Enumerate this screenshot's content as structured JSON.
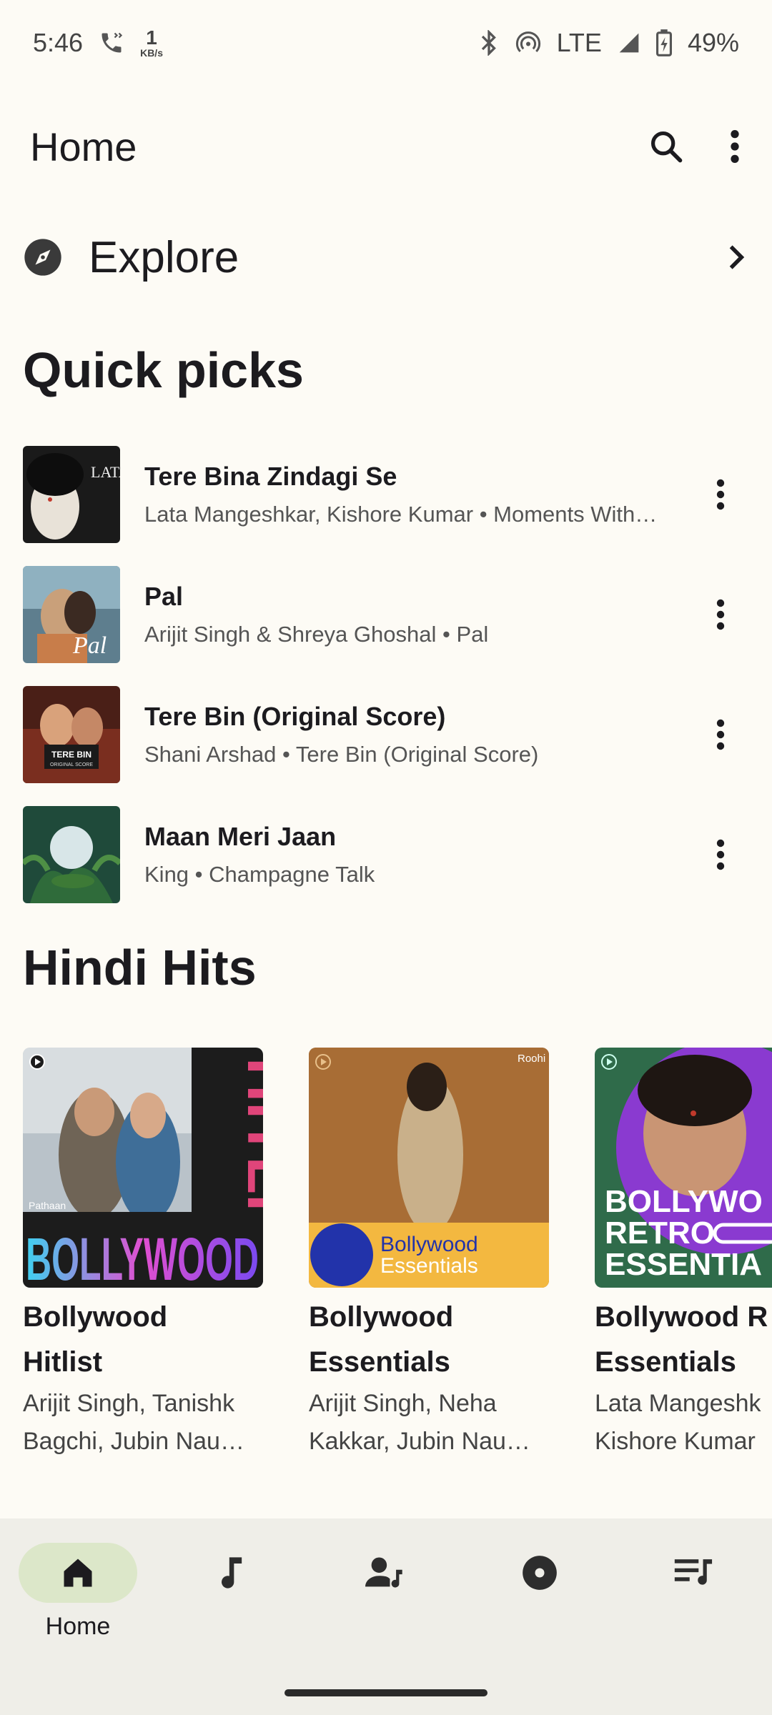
{
  "status_bar": {
    "time": "5:46",
    "data_rate": "1",
    "data_unit": "KB/s",
    "network": "LTE",
    "battery": "49%"
  },
  "app_bar": {
    "title": "Home"
  },
  "explore": {
    "label": "Explore"
  },
  "quick_picks": {
    "title": "Quick picks",
    "songs": [
      {
        "title": "Tere Bina Zindagi Se",
        "subtitle": "Lata Mangeshkar, Kishore Kumar • Moments With…"
      },
      {
        "title": "Pal",
        "subtitle": "Arijit Singh & Shreya Ghoshal • Pal"
      },
      {
        "title": "Tere Bin (Original Score)",
        "subtitle": "Shani Arshad • Tere Bin (Original Score)"
      },
      {
        "title": "Maan Meri Jaan",
        "subtitle": "King • Champagne Talk"
      }
    ]
  },
  "hindi_hits": {
    "title": "Hindi Hits",
    "cards": [
      {
        "title_l1": "Bollywood",
        "title_l2": "Hitlist",
        "sub_l1": "Arijit Singh, Tanishk",
        "sub_l2": "Bagchi, Jubin Nau…",
        "cover_text": "BOLLYWOOD",
        "cover_side_text": "HITLIST",
        "cover_tag": "Pathaan"
      },
      {
        "title_l1": "Bollywood",
        "title_l2": "Essentials",
        "sub_l1": "Arijit Singh, Neha",
        "sub_l2": "Kakkar, Jubin Nau…",
        "cover_text_l1": "Bollywood",
        "cover_text_l2": "Essentials",
        "cover_tag": "Roohi"
      },
      {
        "title_l1": "Bollywood R",
        "title_l2": "Essentials",
        "sub_l1": "Lata Mangeshk",
        "sub_l2": "Kishore Kumar",
        "cover_text_l1": "BOLLYWO",
        "cover_text_l2": "RETRO",
        "cover_text_l3": "ESSENTIA"
      }
    ]
  },
  "bottom_nav": {
    "items": [
      {
        "label": "Home",
        "icon": "home-icon",
        "active": true
      },
      {
        "label": "",
        "icon": "songs-icon",
        "active": false
      },
      {
        "label": "",
        "icon": "artists-icon",
        "active": false
      },
      {
        "label": "",
        "icon": "albums-icon",
        "active": false
      },
      {
        "label": "",
        "icon": "playlists-icon",
        "active": false
      }
    ]
  },
  "colors": {
    "background": "#fdfbf5",
    "nav_background": "#efeee8",
    "nav_active_pill": "#dce7c9",
    "text_primary": "#1c1b1f",
    "text_secondary": "#555555"
  }
}
